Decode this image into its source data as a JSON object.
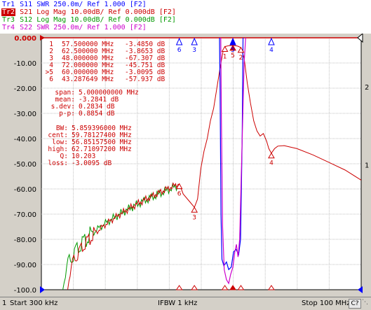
{
  "colors": {
    "tr1": "#0000ff",
    "tr2": "#cc0000",
    "tr3": "#009900",
    "tr4": "#cc00cc"
  },
  "traces": [
    {
      "id": "Tr1",
      "param": "S11",
      "format": "SWR",
      "scale": "250.0m/",
      "ref": "Ref 1.000",
      "tag": "[F2]"
    },
    {
      "id": "Tr2",
      "param": "S21",
      "format": "Log Mag",
      "scale": "10.00dB/",
      "ref": "Ref 0.000dB",
      "tag": "[F2]"
    },
    {
      "id": "Tr3",
      "param": "S12",
      "format": "Log Mag",
      "scale": "10.00dB/",
      "ref": "Ref 0.000dB",
      "tag": "[F2]"
    },
    {
      "id": "Tr4",
      "param": "S22",
      "format": "SWR",
      "scale": "250.0m/",
      "ref": "Ref 1.000",
      "tag": "[F2]"
    }
  ],
  "y_axis": {
    "labels": [
      "0.000",
      "-10.00",
      "-20.00",
      "-30.00",
      "-40.00",
      "-50.00",
      "-60.00",
      "-70.00",
      "-80.00",
      "-90.00",
      "-100.0"
    ],
    "right_labels": [
      "2",
      "1"
    ]
  },
  "marker_table": [
    {
      "prefix": "1",
      "freq": "57.500000 MHz",
      "value": "-3.4850 dB"
    },
    {
      "prefix": "2",
      "freq": "62.500000 MHz",
      "value": "-3.8653 dB"
    },
    {
      "prefix": "3",
      "freq": "48.000000 MHz",
      "value": "-67.307 dB"
    },
    {
      "prefix": "4",
      "freq": "72.000000 MHz",
      "value": "-45.751 dB"
    },
    {
      "prefix": ">5",
      "freq": "60.000000 MHz",
      "value": "-3.0095 dB"
    },
    {
      "prefix": "6",
      "freq": "43.287649 MHz",
      "value": "-57.937 dB"
    }
  ],
  "stats": [
    {
      "label": "span:",
      "value": "5.000000000 MHz"
    },
    {
      "label": "mean:",
      "value": "-3.2841 dB"
    },
    {
      "label": "s.dev:",
      "value": "0.2834 dB"
    },
    {
      "label": "p-p:",
      "value": "0.8854 dB"
    }
  ],
  "bw": [
    {
      "label": "BW:",
      "value": "5.859396000 MHz"
    },
    {
      "label": "cent:",
      "value": "59.78127400 MHz"
    },
    {
      "label": "low:",
      "value": "56.85157500 MHz"
    },
    {
      "label": "high:",
      "value": "62.71097200 MHz"
    },
    {
      "label": "Q:",
      "value": "10.203"
    },
    {
      "label": "loss:",
      "value": "-3.0095 dB"
    }
  ],
  "status": {
    "channel": "1",
    "start": "Start 300 kHz",
    "ifbw": "IFBW 1 kHz",
    "stop": "Stop 100 MHz",
    "badge": "C?"
  }
}
